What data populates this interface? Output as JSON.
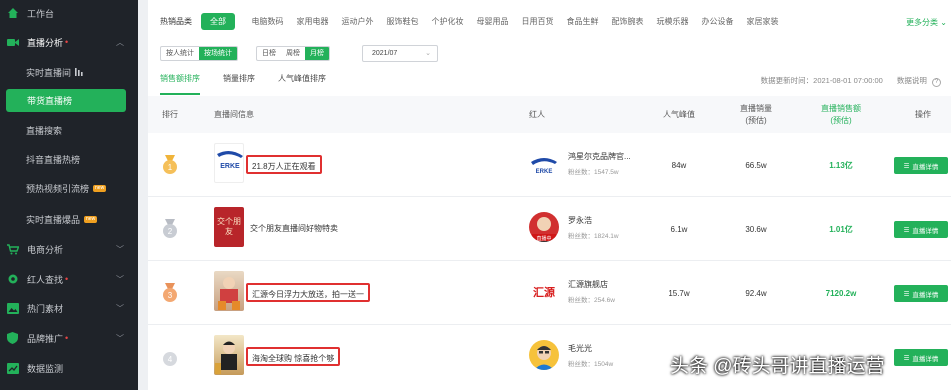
{
  "sidebar": {
    "items": [
      {
        "label": "工作台",
        "icon": "home-icon"
      },
      {
        "label": "直播分析",
        "icon": "video-icon",
        "dot": "•"
      },
      {
        "label": "实时直播间",
        "icon": "bars-icon"
      },
      {
        "label": "带货直播榜"
      },
      {
        "label": "直播搜索"
      },
      {
        "label": "抖音直播热榜"
      },
      {
        "label": "预热视频引流榜",
        "badge": "new"
      },
      {
        "label": "实时直播爆品",
        "badge": "new"
      },
      {
        "label": "电商分析",
        "icon": "cart-icon"
      },
      {
        "label": "红人查找",
        "icon": "gear-icon",
        "dot": "•"
      },
      {
        "label": "热门素材",
        "icon": "image-icon"
      },
      {
        "label": "品牌推广",
        "icon": "shield-icon",
        "dot": "•"
      },
      {
        "label": "数据监测",
        "icon": "chart-icon"
      }
    ]
  },
  "categories": {
    "label": "热销品类",
    "items": [
      "全部",
      "电脑数码",
      "家用电器",
      "运动户外",
      "服饰鞋包",
      "个护化妆",
      "母婴用品",
      "日用百货",
      "食品生鲜",
      "配饰腕表",
      "玩模乐器",
      "办公设备",
      "家居家装"
    ],
    "more": "更多分类 ⌄"
  },
  "filters": {
    "group1": [
      "按人统计",
      "按场统计"
    ],
    "group2": [
      "日榜",
      "周榜",
      "月榜"
    ],
    "date": "2021/07"
  },
  "tabs": [
    "销售额排序",
    "销量排序",
    "人气峰值排序"
  ],
  "update_text": "数据更新时间：2021-08-01 07:00:00",
  "help": "数据说明",
  "columns": {
    "rank": "排行",
    "room": "直播间信息",
    "host": "红人",
    "peak": "人气峰值",
    "sales_qty": "直播销量\n(预估)",
    "sales_amt": "直播销售额\n(预估)",
    "action": "操作"
  },
  "rows": [
    {
      "rank": "1",
      "room_title": "21.8万人正在观看",
      "thumb_text": "ERKE",
      "host": "鸿星尔克品牌官...",
      "fans": "粉丝数：1547.5w",
      "peak": "84w",
      "qty": "66.5w",
      "amount": "1.13亿",
      "action": "直播详情"
    },
    {
      "rank": "2",
      "room_title": "交个朋友直播间好物特卖",
      "thumb_text": "交个朋友",
      "host": "罗永浩",
      "fans": "粉丝数：1824.1w",
      "peak": "6.1w",
      "qty": "30.6w",
      "amount": "1.01亿",
      "action": "直播详情",
      "avatar_badge": "直播中"
    },
    {
      "rank": "3",
      "room_title": "汇源今日浮力大放送，拍一送一",
      "thumb_text": "",
      "host": "汇源旗舰店",
      "fans": "粉丝数：254.6w",
      "peak": "15.7w",
      "qty": "92.4w",
      "amount": "7120.2w",
      "action": "直播详情",
      "avatar_text": "汇源"
    },
    {
      "rank": "4",
      "room_title": "海淘全球购 惊喜抢个够",
      "thumb_text": "",
      "host": "毛光光",
      "fans": "粉丝数：1504w",
      "peak": "",
      "qty": "",
      "amount": "",
      "action": "直播详情"
    }
  ],
  "watermark": "头条 @砖头哥讲直播运营",
  "colors": {
    "accent": "#23b15a",
    "sidebar_bg": "#1f2329",
    "highlight_box": "#e03030"
  }
}
